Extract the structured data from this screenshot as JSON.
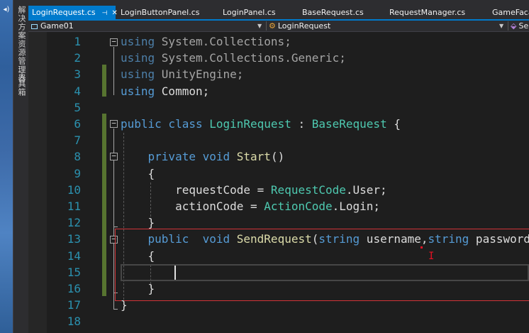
{
  "sidebar": {
    "explorer_label": "解决方案资源管理器",
    "toolbox_label": "工具箱"
  },
  "tabs": [
    {
      "label": "LoginRequest.cs",
      "active": true
    },
    {
      "label": "LoginButtonPanel.cs"
    },
    {
      "label": "LoginPanel.cs"
    },
    {
      "label": "BaseRequest.cs"
    },
    {
      "label": "RequestManager.cs"
    },
    {
      "label": "GameFaca"
    }
  ],
  "navbar": {
    "project": "Game01",
    "class": "LoginRequest",
    "member": "Sen"
  },
  "editor": {
    "line_numbers": [
      "1",
      "2",
      "3",
      "4",
      "5",
      "6",
      "7",
      "8",
      "9",
      "10",
      "11",
      "12",
      "13",
      "14",
      "15",
      "16",
      "17",
      "18"
    ],
    "lines": [
      [
        {
          "t": "using ",
          "c": "kw-dim"
        },
        {
          "t": "System.Collections;",
          "c": "plain-dim"
        }
      ],
      [
        {
          "t": "using ",
          "c": "kw-dim"
        },
        {
          "t": "System.Collections.Generic;",
          "c": "plain-dim"
        }
      ],
      [
        {
          "t": "using ",
          "c": "kw-dim"
        },
        {
          "t": "UnityEngine;",
          "c": "plain-dim"
        }
      ],
      [
        {
          "t": "using ",
          "c": "kw"
        },
        {
          "t": "Common;",
          "c": ""
        }
      ],
      [],
      [
        {
          "t": "public class ",
          "c": "kw"
        },
        {
          "t": "LoginRequest",
          "c": "type"
        },
        {
          "t": " : ",
          "c": ""
        },
        {
          "t": "BaseRequest",
          "c": "type"
        },
        {
          "t": " {",
          "c": ""
        }
      ],
      [],
      [
        {
          "t": "    ",
          "c": ""
        },
        {
          "t": "private void ",
          "c": "kw"
        },
        {
          "t": "Start",
          "c": "meth"
        },
        {
          "t": "()",
          "c": ""
        }
      ],
      [
        {
          "t": "    {",
          "c": ""
        }
      ],
      [
        {
          "t": "        requestCode = ",
          "c": ""
        },
        {
          "t": "RequestCode",
          "c": "type"
        },
        {
          "t": ".User;",
          "c": ""
        }
      ],
      [
        {
          "t": "        actionCode = ",
          "c": ""
        },
        {
          "t": "ActionCode",
          "c": "type"
        },
        {
          "t": ".Login;",
          "c": ""
        }
      ],
      [
        {
          "t": "    }",
          "c": ""
        }
      ],
      [
        {
          "t": "    ",
          "c": ""
        },
        {
          "t": "public  void ",
          "c": "kw"
        },
        {
          "t": "SendRequest",
          "c": "meth"
        },
        {
          "t": "(",
          "c": ""
        },
        {
          "t": "string",
          "c": "kw"
        },
        {
          "t": " username,",
          "c": ""
        },
        {
          "t": "string",
          "c": "kw"
        },
        {
          "t": " password)",
          "c": ""
        }
      ],
      [
        {
          "t": "    {",
          "c": ""
        }
      ],
      [],
      [
        {
          "t": "    }",
          "c": ""
        }
      ],
      [
        {
          "t": "}",
          "c": ""
        }
      ],
      []
    ]
  },
  "colors": {
    "accent": "#007acc",
    "change_marker": "#577430",
    "annotation_box": "#d13438"
  }
}
